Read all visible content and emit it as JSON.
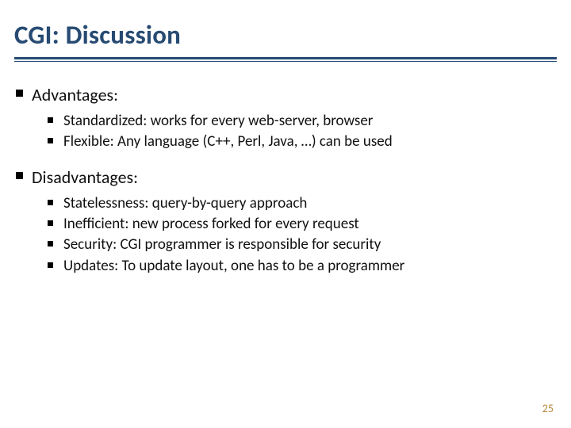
{
  "title": "CGI: Discussion",
  "sections": [
    {
      "heading": "Advantages:",
      "items": [
        "Standardized: works for every web-server, browser",
        "Flexible: Any language (C++, Perl, Java, …) can be used"
      ]
    },
    {
      "heading": "Disadvantages:",
      "items": [
        "Statelessness: query-by-query approach",
        "Inefficient: new process forked for every request",
        "Security: CGI programmer is responsible for security",
        "Updates: To update layout, one has to be a programmer"
      ]
    }
  ],
  "page_number": "25"
}
